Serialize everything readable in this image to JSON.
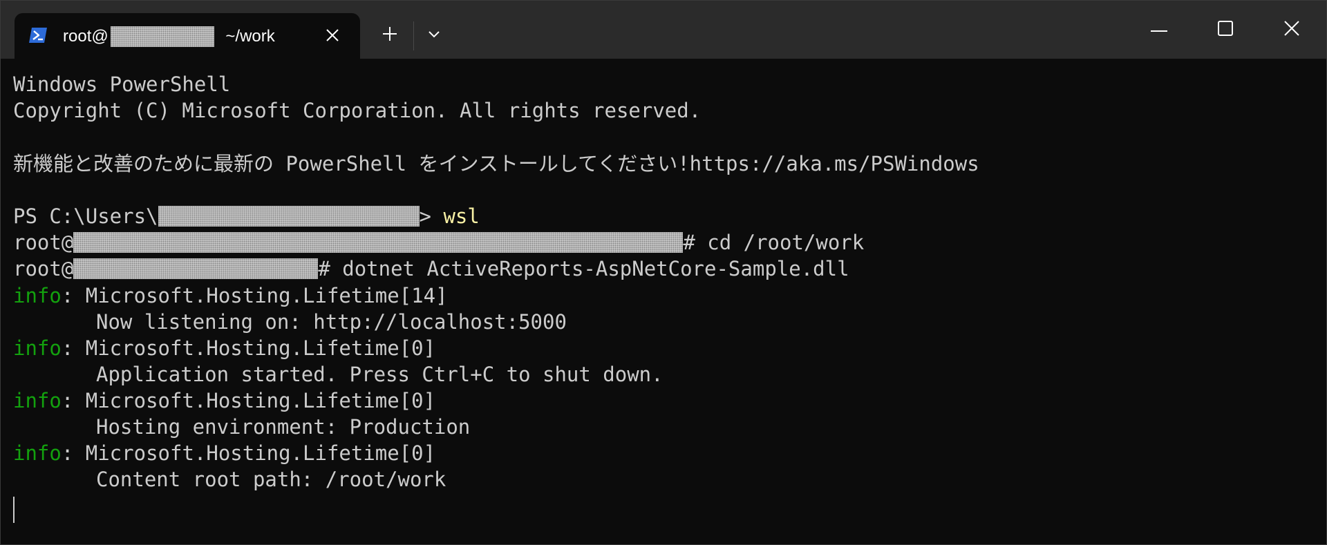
{
  "tab": {
    "title_prefix": "root@",
    "title_suffix": " ~/work",
    "icon": "powershell-icon"
  },
  "titlebar": {
    "close_tab_icon": "close-icon",
    "new_tab_icon": "plus-icon",
    "dropdown_icon": "chevron-down-icon",
    "minimize_icon": "minimize-icon",
    "maximize_icon": "maximize-icon",
    "close_window_icon": "close-icon"
  },
  "terminal": {
    "banner_line1": "Windows PowerShell",
    "banner_line2": "Copyright (C) Microsoft Corporation. All rights reserved.",
    "install_message": "新機能と改善のために最新の PowerShell をインストールしてください!https://aka.ms/PSWindows",
    "ps_prompt_prefix": "PS C:\\Users\\",
    "ps_prompt_suffix": ">",
    "ps_command": " wsl",
    "root_prompt": "root@",
    "cmd1": "# cd /root/work",
    "cmd2": "# dotnet ActiveReports-AspNetCore-Sample.dll",
    "log_level": "info",
    "log_sep": ": ",
    "log": [
      {
        "category": "Microsoft.Hosting.Lifetime[14]",
        "message": "Now listening on: http://localhost:5000"
      },
      {
        "category": "Microsoft.Hosting.Lifetime[0]",
        "message": "Application started. Press Ctrl+C to shut down."
      },
      {
        "category": "Microsoft.Hosting.Lifetime[0]",
        "message": "Hosting environment: Production"
      },
      {
        "category": "Microsoft.Hosting.Lifetime[0]",
        "message": "Content root path: /root/work"
      }
    ]
  },
  "colors": {
    "background": "#0c0c0c",
    "titlebar": "#2b2b2b",
    "foreground": "#cccccc",
    "info_green": "#13a10e",
    "command_yellow": "#f9f1a5",
    "ps_icon_blue": "#2d6bd8"
  }
}
